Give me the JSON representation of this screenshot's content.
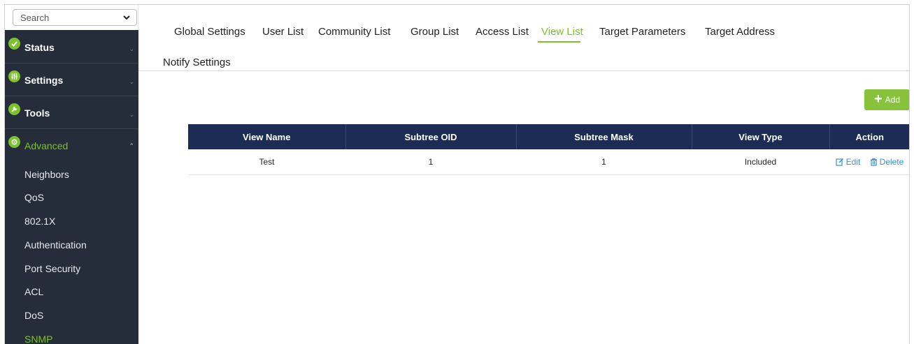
{
  "sidebar": {
    "search": {
      "label": "Search"
    },
    "groups": [
      {
        "label": "Status",
        "icon": "check-icon"
      },
      {
        "label": "Settings",
        "icon": "sliders-icon"
      },
      {
        "label": "Tools",
        "icon": "wrench-icon"
      },
      {
        "label": "Advanced",
        "icon": "gear-icon",
        "expanded": true
      }
    ],
    "advanced_items": [
      {
        "label": "Neighbors"
      },
      {
        "label": "QoS"
      },
      {
        "label": "802.1X"
      },
      {
        "label": "Authentication"
      },
      {
        "label": "Port Security"
      },
      {
        "label": "ACL"
      },
      {
        "label": "DoS"
      },
      {
        "label": "SNMP",
        "active": true
      }
    ]
  },
  "tabs": [
    {
      "label": "Global Settings"
    },
    {
      "label": "User List"
    },
    {
      "label": "Community List"
    },
    {
      "label": "Group List"
    },
    {
      "label": "Access List"
    },
    {
      "label": "View List",
      "active": true
    },
    {
      "label": "Target Parameters"
    },
    {
      "label": "Target Address"
    },
    {
      "label": "Notify Settings"
    }
  ],
  "toolbar": {
    "add_label": "Add"
  },
  "table": {
    "headers": [
      "View Name",
      "Subtree OID",
      "Subtree Mask",
      "View Type",
      "Action"
    ],
    "rows": [
      {
        "view_name": "Test",
        "subtree_oid": "1",
        "subtree_mask": "1",
        "view_type": "Included",
        "edit_label": "Edit",
        "delete_label": "Delete"
      }
    ]
  },
  "colors": {
    "accent": "#7dc12f",
    "sidebar_bg": "#252d3a",
    "table_header_bg": "#1c2c55",
    "link": "#3a8fd8"
  }
}
